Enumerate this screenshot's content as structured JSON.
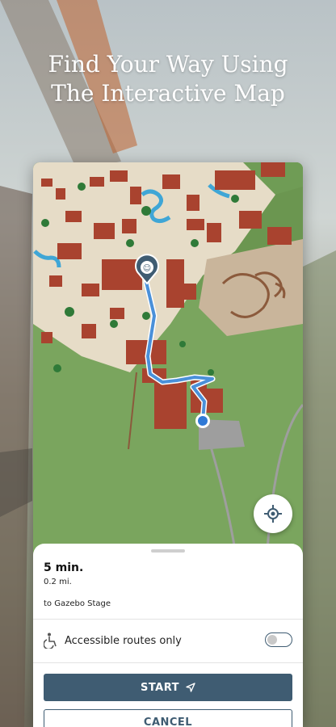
{
  "headline": {
    "line1": "Find Your Way Using",
    "line2": "The Interactive Map"
  },
  "route": {
    "eta": "5 min.",
    "distance": "0.2 mi.",
    "destination": "to Gazebo Stage"
  },
  "accessible": {
    "label": "Accessible routes only",
    "enabled": false
  },
  "buttons": {
    "start": "START",
    "cancel": "CANCEL"
  },
  "icons": {
    "start": "navigation-arrow-icon",
    "locate": "crosshair-locate-icon",
    "accessible": "wheelchair-icon",
    "pin": "theater-masks-pin-icon"
  },
  "colors": {
    "primary": "#3f5c72",
    "route": "#4a90d9",
    "map_green": "#6f9c55",
    "roof": "#a9432f"
  }
}
